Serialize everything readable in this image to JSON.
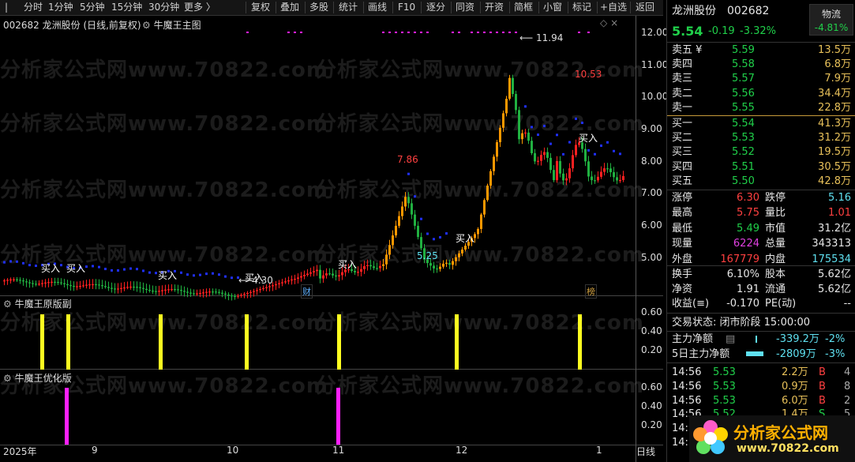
{
  "toolbar": {
    "left_items": [
      "分时",
      "1分钟",
      "5分钟",
      "15分钟",
      "30分钟",
      "更多 〉"
    ],
    "right_items": [
      "复权",
      "叠加",
      "多股",
      "统计",
      "画线",
      "F10",
      "逐分",
      "同资",
      "开资",
      "简框",
      "小窗",
      "标记",
      "+自选",
      "返回"
    ]
  },
  "chart": {
    "main_title": "002682  龙洲股份 (日线,前复权)",
    "main_indicator": "牛魔王主图",
    "sub1_title": "牛魔王原版副",
    "sub2_title": "牛魔王优化版",
    "max_label": "11.94",
    "high_label": "10.53",
    "label_786": "7.86",
    "label_525": "5.25",
    "label_430": "4.30",
    "buy_label": "买入",
    "marker_cai": "财",
    "marker_bang": "榜",
    "watermark": "分析家公式网www.70822.com",
    "main_axis": [
      "12.00",
      "11.00",
      "10.00",
      "9.00",
      "8.00",
      "7.00",
      "6.00",
      "5.00"
    ],
    "sub1_axis": [
      "0.60",
      "0.40",
      "0.20"
    ],
    "sub2_axis": [
      "0.60",
      "0.40",
      "0.20"
    ],
    "x_axis": [
      "2025年",
      "9",
      "10",
      "11",
      "12",
      "1"
    ],
    "x_end": "日线",
    "colors": {
      "up": "#ff2020",
      "down": "#20b040",
      "orange": "#ff9800",
      "yellow": "#ffff20",
      "blue": "#2030ff",
      "magenta": "#ff20ff"
    }
  },
  "quote": {
    "name": "龙洲股份",
    "code": "002682",
    "tab": "物流",
    "tab_change": "-4.81%",
    "price": "5.54",
    "change": "-0.19",
    "change_pct": "-3.32%",
    "asks": [
      {
        "label": "卖五 ¥",
        "price": "5.59",
        "vol": "13.5万"
      },
      {
        "label": "卖四",
        "price": "5.58",
        "vol": "6.8万"
      },
      {
        "label": "卖三",
        "price": "5.57",
        "vol": "7.9万"
      },
      {
        "label": "卖二",
        "price": "5.56",
        "vol": "34.4万"
      },
      {
        "label": "卖一",
        "price": "5.55",
        "vol": "22.8万"
      }
    ],
    "bids": [
      {
        "label": "买一",
        "price": "5.54",
        "vol": "41.3万"
      },
      {
        "label": "买二",
        "price": "5.53",
        "vol": "31.2万"
      },
      {
        "label": "买三",
        "price": "5.52",
        "vol": "19.5万"
      },
      {
        "label": "买四",
        "price": "5.51",
        "vol": "30.5万"
      },
      {
        "label": "买五",
        "price": "5.50",
        "vol": "42.8万"
      }
    ],
    "stats": [
      {
        "l1": "涨停",
        "v1": "6.30",
        "l2": "跌停",
        "v2": "5.16"
      },
      {
        "l1": "最高",
        "v1": "5.75",
        "l2": "量比",
        "v2": "1.01"
      },
      {
        "l1": "最低",
        "v1": "5.49",
        "l2": "市值",
        "v2": "31.2亿"
      },
      {
        "l1": "现量",
        "v1": "6224",
        "l2": "总量",
        "v2": "343313"
      },
      {
        "l1": "外盘",
        "v1": "167779",
        "l2": "内盘",
        "v2": "175534"
      }
    ],
    "stats2": [
      {
        "l1": "换手",
        "v1": "6.10%",
        "l2": "股本",
        "v2": "5.62亿"
      },
      {
        "l1": "净资",
        "v1": "1.91",
        "l2": "流通",
        "v2": "5.62亿"
      },
      {
        "l1": "收益(≡)",
        "v1": "-0.170",
        "l2": "PE(动)",
        "v2": "--"
      }
    ],
    "status": "交易状态: 闭市阶段 15:00:00",
    "flow1": {
      "label": "主力净额",
      "value": "-339.2万",
      "pct": "-2%"
    },
    "flow2": {
      "label": "5日主力净额",
      "value": "-2809万",
      "pct": "-3%"
    },
    "ticks": [
      {
        "time": "14:56",
        "price": "5.53",
        "vol": "2.2万",
        "side": "B",
        "n": "4"
      },
      {
        "time": "14:56",
        "price": "5.53",
        "vol": "0.9万",
        "side": "B",
        "n": "8"
      },
      {
        "time": "14:56",
        "price": "5.53",
        "vol": "6.0万",
        "side": "B",
        "n": "2"
      },
      {
        "time": "14:56",
        "price": "5.52",
        "vol": "1.4万",
        "side": "S",
        "n": "5"
      },
      {
        "time": "14:",
        "price": "",
        "vol": "",
        "side": "",
        "n": ""
      },
      {
        "time": "14:",
        "price": "",
        "vol": "",
        "side": "",
        "n": ""
      }
    ],
    "logo_text": "分析家公式网",
    "logo_url": "www.70822.com"
  }
}
